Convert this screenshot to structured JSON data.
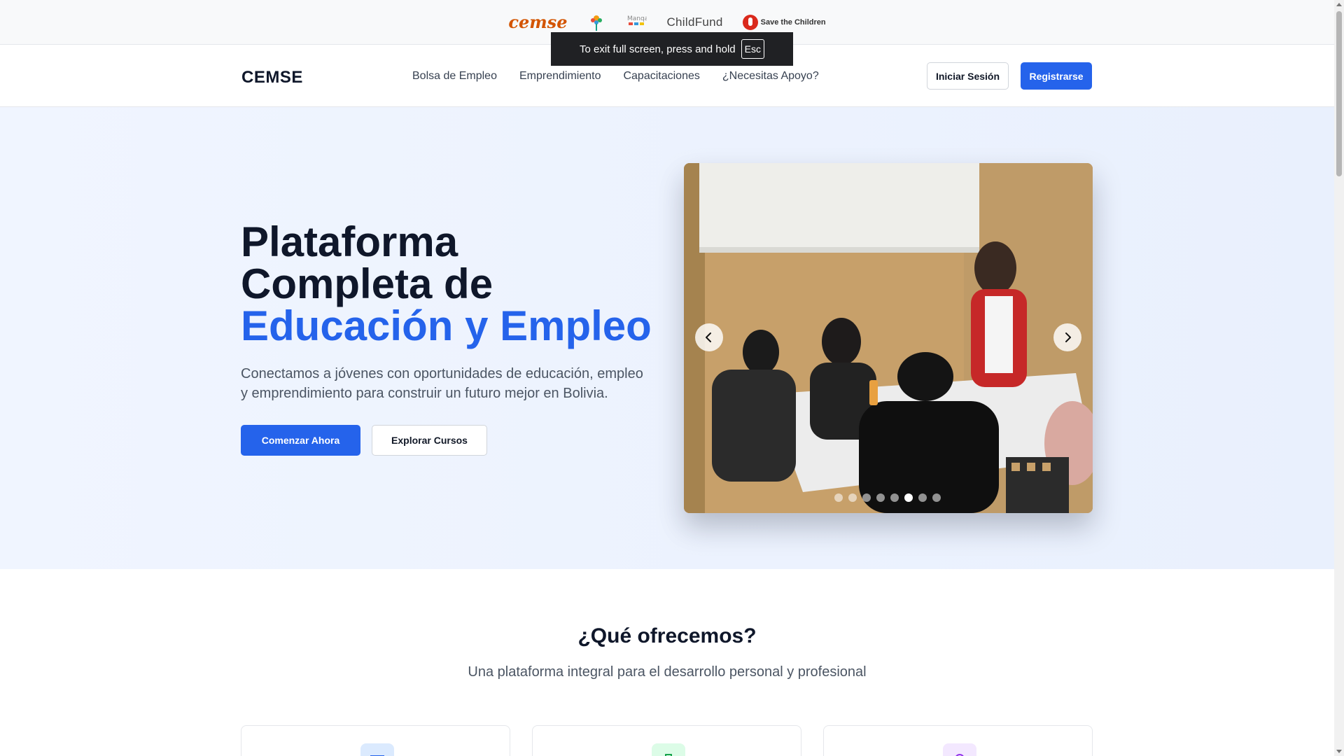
{
  "partners": {
    "cemse_logo": "cemse",
    "childfund_logo": "ChildFund",
    "stc_logo": "Save the Children"
  },
  "fullscreen_notice": {
    "text": "To exit full screen, press and hold",
    "key": "Esc"
  },
  "nav": {
    "brand": "CEMSE",
    "links": [
      "Bolsa de Empleo",
      "Emprendimiento",
      "Capacitaciones",
      "¿Necesitas Apoyo?"
    ],
    "login": "Iniciar Sesión",
    "register": "Registrarse"
  },
  "hero": {
    "title_line1": "Plataforma",
    "title_line2": "Completa de",
    "title_accent": "Educación y Empleo",
    "description": "Conectamos a jóvenes con oportunidades de educación, empleo y emprendimiento para construir un futuro mejor en Bolivia.",
    "primary_button": "Comenzar Ahora",
    "secondary_button": "Explorar Cursos",
    "carousel": {
      "slide_count": 8,
      "active_slide": 6,
      "prev_icon": "chevron-left-icon",
      "next_icon": "chevron-right-icon"
    }
  },
  "offer": {
    "title": "¿Qué ofrecemos?",
    "subtitle": "Una plataforma integral para el desarrollo personal y profesional",
    "card_icons": [
      "book-icon",
      "briefcase-icon",
      "lightbulb-icon"
    ]
  },
  "colors": {
    "primary": "#2563eb",
    "text_dark": "#0f172a",
    "hero_bg": "#eef3fd"
  }
}
